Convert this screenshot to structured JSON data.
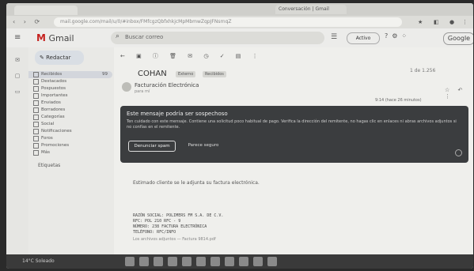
{
  "browser": {
    "url_text": "mail.google.com/mail/u/0/#inbox/FMfcgzQbfxhkjcMpMbmwZqpJFNsrnqZ",
    "tab_label": "Conversación | Gmail"
  },
  "header": {
    "logo_text": "Gmail",
    "search_placeholder": "Buscar correo",
    "status_label": "Activo",
    "google_label": "Google"
  },
  "sidebar": {
    "compose_label": "Redactar",
    "items": [
      {
        "label": "Recibidos",
        "count": "99"
      },
      {
        "label": "Destacados",
        "count": ""
      },
      {
        "label": "Pospuestos",
        "count": ""
      },
      {
        "label": "Importantes",
        "count": ""
      },
      {
        "label": "Enviados",
        "count": ""
      },
      {
        "label": "Borradores",
        "count": ""
      },
      {
        "label": "Categorías",
        "count": ""
      },
      {
        "label": "Social",
        "count": ""
      },
      {
        "label": "Notificaciones",
        "count": ""
      },
      {
        "label": "Foros",
        "count": ""
      },
      {
        "label": "Promociones",
        "count": ""
      },
      {
        "label": "Más",
        "count": ""
      }
    ],
    "labels_heading": "Etiquetas"
  },
  "email": {
    "subject": "COHAN",
    "chips": [
      "Externo",
      "Recibidos"
    ],
    "sender": "Facturación Electrónica",
    "recipient_line": "para mí",
    "date_text": "9:14 (hace 26 minutos)",
    "pager": "1 de 1.256"
  },
  "banner": {
    "title": "Este mensaje podría ser sospechoso",
    "text": "Ten cuidado con este mensaje. Contiene una solicitud poco habitual de pago. Verifica la dirección del remitente, no hagas clic en enlaces ni abras archivos adjuntos si no confías en el remitente.",
    "primary_button": "Denunciar spam",
    "secondary_button": "Parece seguro"
  },
  "body": {
    "intro": "Estimado cliente se le adjunta su factura electrónica.",
    "lines": [
      "RAZÓN SOCIAL:  POLIMERS FM S.A. DE C.V.",
      "RFC:           POL 210 RFC - 9",
      "NÚMERO:        238 FACTURA ELECTRÓNICA",
      "TELÉFONO:      RFC/INFO"
    ],
    "footer": "Los archivos adjuntos — Factura 9814.pdf"
  },
  "taskbar": {
    "weather": "14°C Soleado"
  }
}
